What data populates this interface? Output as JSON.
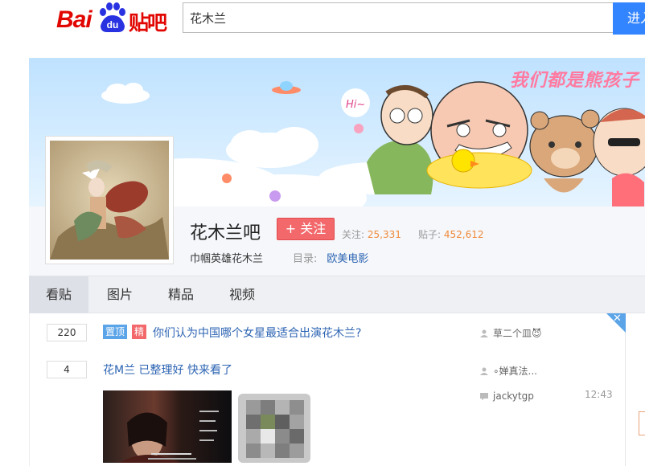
{
  "header": {
    "logo_bai": "Bai",
    "logo_du": "du",
    "logo_tieba": "贴吧",
    "search_value": "花木兰",
    "search_button": "进入"
  },
  "banner": {
    "slogan": "我们都是熊孩子",
    "bubble": "Hi~"
  },
  "forum": {
    "name": "花木兰吧",
    "follow_label": "+ 关注",
    "followers_label": "关注:",
    "followers": "25,331",
    "posts_label": "贴子:",
    "posts": "452,612",
    "slogan": "巾帼英雄花木兰",
    "directory_label": "目录:",
    "directory": "欧美电影"
  },
  "tabs": [
    {
      "label": "看贴",
      "active": true
    },
    {
      "label": "图片",
      "active": false
    },
    {
      "label": "精品",
      "active": false
    },
    {
      "label": "视频",
      "active": false
    }
  ],
  "threads": [
    {
      "replies": "220",
      "badges": [
        "置顶",
        "精"
      ],
      "title": "你们认为中国哪个女星最适合出演花木兰?",
      "author": "草二个皿😈",
      "last_reply": "",
      "time": ""
    },
    {
      "replies": "4",
      "badges": [],
      "title": "花M兰 已整理好 快来看了",
      "author": "∘婵真法...",
      "last_reply": "jackytgp",
      "time": "12:43"
    }
  ],
  "colors": {
    "accent": "#3385ff",
    "follow": "#f2686b",
    "link": "#2d64b3",
    "stat": "#f08a3b",
    "top_badge": "#5ba4e8",
    "essence_badge": "#f2686b"
  }
}
